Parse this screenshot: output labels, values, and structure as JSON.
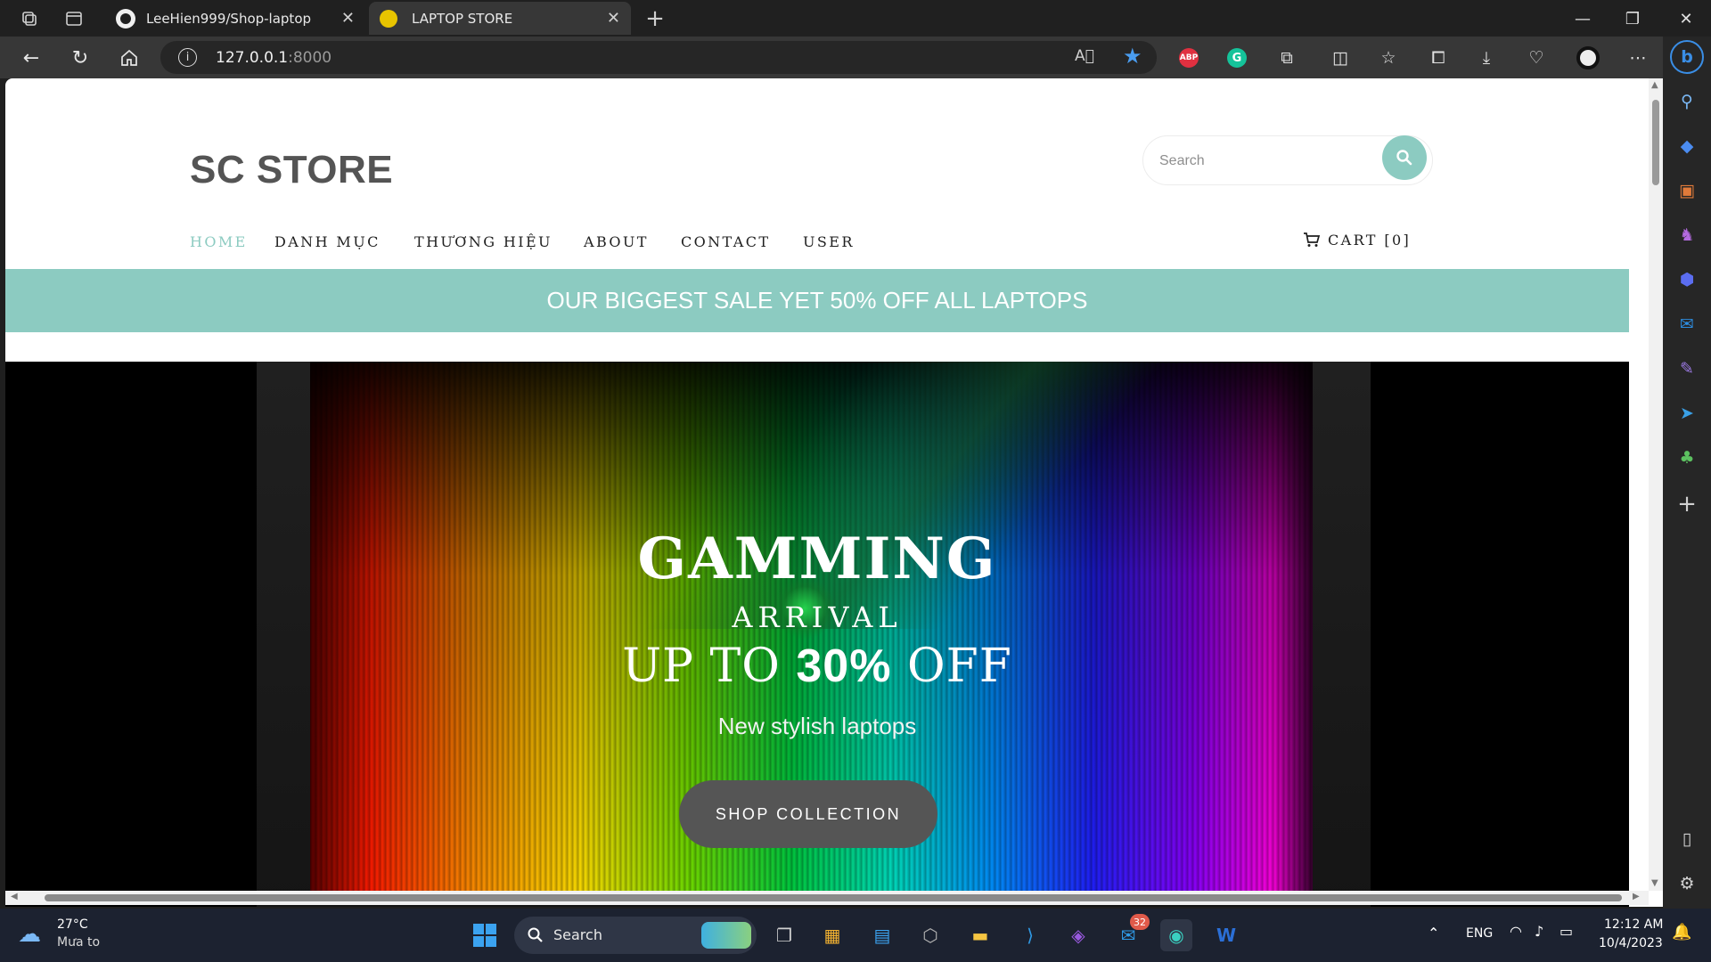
{
  "browser": {
    "tabs": [
      {
        "title": "LeeHien999/Shop-laptop",
        "icon": "github-icon",
        "active": false
      },
      {
        "title": "LAPTOP STORE",
        "icon": "store-icon",
        "active": true
      }
    ],
    "url_host": "127.0.0.1",
    "url_port": ":8000"
  },
  "site": {
    "logo": "SC STORE",
    "search_placeholder": "Search",
    "menu": [
      "HOME",
      "DANH MỤC",
      "THƯƠNG HIỆU",
      "ABOUT",
      "CONTACT",
      "USER"
    ],
    "active_menu": "HOME",
    "cart_label": "CART [0]",
    "sale_banner": "OUR BIGGEST SALE YET 50% OFF ALL LAPTOPS",
    "accent_color": "#8ccbc1"
  },
  "hero": {
    "title": "GAMMING",
    "subtitle": "ARRIVAL",
    "offer_prefix": "UP TO ",
    "offer_value": "30%",
    "offer_suffix": " OFF",
    "tagline": "New stylish laptops",
    "cta": "SHOP COLLECTION"
  },
  "taskbar": {
    "weather_temp": "27°C",
    "weather_desc": "Mưa to",
    "search_label": "Search",
    "badge_count": "32",
    "language": "ENG",
    "time": "12:12 AM",
    "date": "10/4/2023"
  }
}
